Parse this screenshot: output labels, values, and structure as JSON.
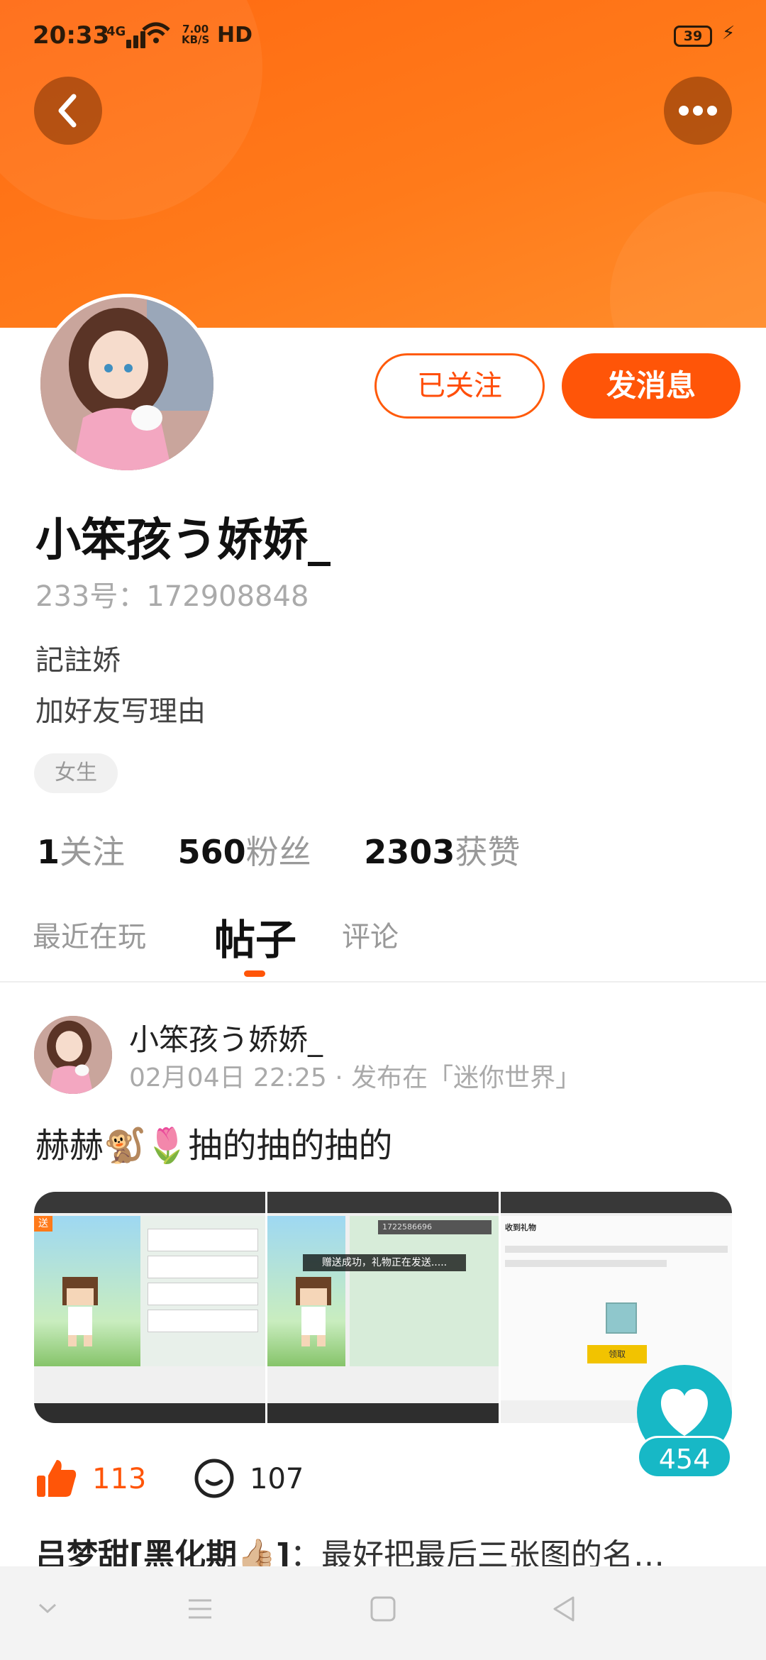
{
  "status_bar": {
    "time": "20:33",
    "network": "4G",
    "speed_value": "7.00",
    "speed_unit": "KB/S",
    "hd": "HD",
    "battery": "39"
  },
  "header": {
    "back_icon": "chevron-left-icon",
    "more_icon": "more-dots-icon",
    "accent_color": "#ff5508"
  },
  "profile": {
    "name": "小笨孩う娇娇_",
    "uid": "233号：172908848",
    "bio_line1": "記註娇",
    "bio_line2": "加好友写理由",
    "tag": "女生",
    "follow_button": "已关注",
    "message_button": "发消息",
    "stats": [
      {
        "value": "1",
        "label": "关注"
      },
      {
        "value": "560",
        "label": "粉丝"
      },
      {
        "value": "2303",
        "label": "获赞"
      }
    ]
  },
  "tabs": [
    {
      "label": "最近在玩",
      "active": false
    },
    {
      "label": "帖子",
      "active": true
    },
    {
      "label": "评论",
      "active": false
    }
  ],
  "post": {
    "author": "小笨孩う娇娇_",
    "meta": "02月04日 22:25 · 发布在「迷你世界」",
    "text": "赫赫🐒🌷抽的抽的抽的",
    "images": [
      {
        "toast": "",
        "header_text": "送"
      },
      {
        "toast": "赠送成功，礼物正在发送.....",
        "header_text": "1722586696"
      },
      {
        "toast": "",
        "header_text": "收到礼物",
        "button": "领取"
      }
    ],
    "like_count": "113",
    "comment_count": "107",
    "fab_like_count": "454",
    "comment_preview_name": "吕梦甜[黑化期👍🏼]",
    "comment_preview_text": "：最好把最后三张图的名…"
  }
}
